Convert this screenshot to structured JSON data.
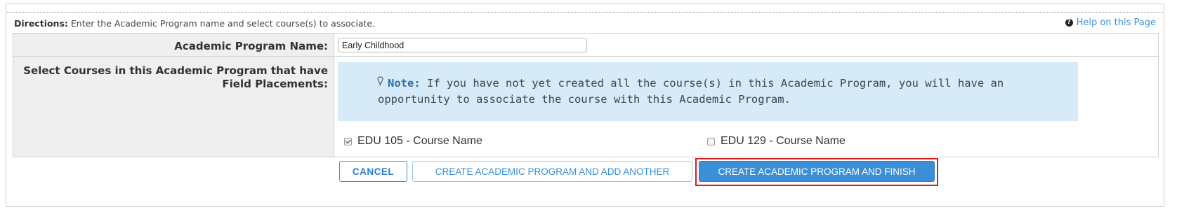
{
  "directions": {
    "prefix": "Directions:",
    "text": " Enter the Academic Program name and select course(s) to associate."
  },
  "help": {
    "label": "Help on this Page",
    "icon": "question-circle-icon"
  },
  "form": {
    "program_name_label": "Academic Program Name:",
    "program_name_value": "Early Childhood",
    "courses_label_line1": "Select Courses in this Academic Program that have",
    "courses_label_line2": "Field Placements:"
  },
  "note": {
    "label": "Note:",
    "text_line1": " If you have not yet created all the course(s) in this Academic Program, you will have an",
    "text_line2": "opportunity to associate the course with this Academic Program.",
    "icon": "lightbulb-icon",
    "background": "#d6eaf8"
  },
  "courses": [
    {
      "label": "EDU 105 - Course Name",
      "checked": true
    },
    {
      "label": "EDU 129 - Course Name",
      "checked": false
    }
  ],
  "buttons": {
    "cancel": "CANCEL",
    "create_add_another": "CREATE ACADEMIC PROGRAM AND ADD ANOTHER",
    "create_finish": "CREATE ACADEMIC PROGRAM AND FINISH"
  },
  "colors": {
    "accent": "#3a8fd6",
    "highlight_outline": "#d42020"
  }
}
